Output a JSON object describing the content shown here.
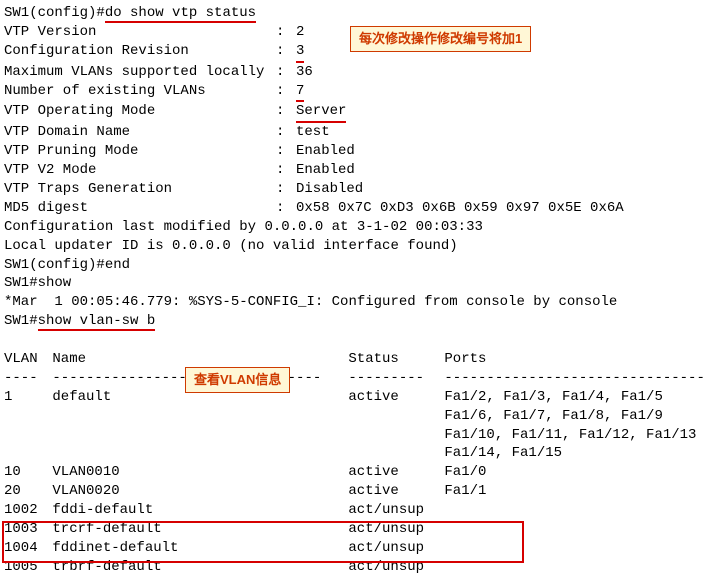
{
  "prompt1_prefix": "SW1(config)#",
  "cmd1": "do show vtp status",
  "vtp": {
    "version_label": "VTP Version",
    "version_value": "2",
    "cfgrev_label": "Configuration Revision",
    "cfgrev_value": "3",
    "maxvlan_label": "Maximum VLANs supported locally",
    "maxvlan_value": "36",
    "numvlan_label": "Number of existing VLANs",
    "numvlan_value": "7",
    "mode_label": "VTP Operating Mode",
    "mode_value": "Server",
    "domain_label": "VTP Domain Name",
    "domain_value": "test",
    "prune_label": "VTP Pruning Mode",
    "prune_value": "Enabled",
    "v2_label": "VTP V2 Mode",
    "v2_value": "Enabled",
    "traps_label": "VTP Traps Generation",
    "traps_value": "Disabled",
    "md5_label": "MD5 digest",
    "md5_value": "0x58 0x7C 0xD3 0x6B 0x59 0x97 0x5E 0x6A"
  },
  "cfg_last": "Configuration last modified by 0.0.0.0 at 3-1-02 00:03:33",
  "updater": "Local updater ID is 0.0.0.0 (no valid interface found)",
  "prompt2": "SW1(config)#end",
  "prompt3": "SW1#show",
  "syslog": "*Mar  1 00:05:46.779: %SYS-5-CONFIG_I: Configured from console by console",
  "prompt4_prefix": "SW1#",
  "cmd2": "show vlan-sw b",
  "callout1": "每次修改操作修改编号将加1",
  "callout2": "查看VLAN信息",
  "vlan_table": {
    "hdr_vlan": "VLAN",
    "hdr_name": "Name",
    "hdr_status": "Status",
    "hdr_ports": "Ports",
    "sep_vlan": "----",
    "sep_name": "--------------------------------",
    "sep_status": "---------",
    "sep_ports": "-------------------------------",
    "rows": [
      {
        "vlan": "1",
        "name": "default",
        "status": "active",
        "ports": [
          "Fa1/2, Fa1/3, Fa1/4, Fa1/5",
          "Fa1/6, Fa1/7, Fa1/8, Fa1/9",
          "Fa1/10, Fa1/11, Fa1/12, Fa1/13",
          "Fa1/14, Fa1/15"
        ]
      },
      {
        "vlan": "10",
        "name": "VLAN0010",
        "status": "active",
        "ports": [
          "Fa1/0"
        ]
      },
      {
        "vlan": "20",
        "name": "VLAN0020",
        "status": "active",
        "ports": [
          "Fa1/1"
        ]
      },
      {
        "vlan": "1002",
        "name": "fddi-default",
        "status": "act/unsup",
        "ports": []
      },
      {
        "vlan": "1003",
        "name": "trcrf-default",
        "status": "act/unsup",
        "ports": []
      },
      {
        "vlan": "1004",
        "name": "fddinet-default",
        "status": "act/unsup",
        "ports": []
      },
      {
        "vlan": "1005",
        "name": "trbrf-default",
        "status": "act/unsup",
        "ports": []
      }
    ]
  }
}
